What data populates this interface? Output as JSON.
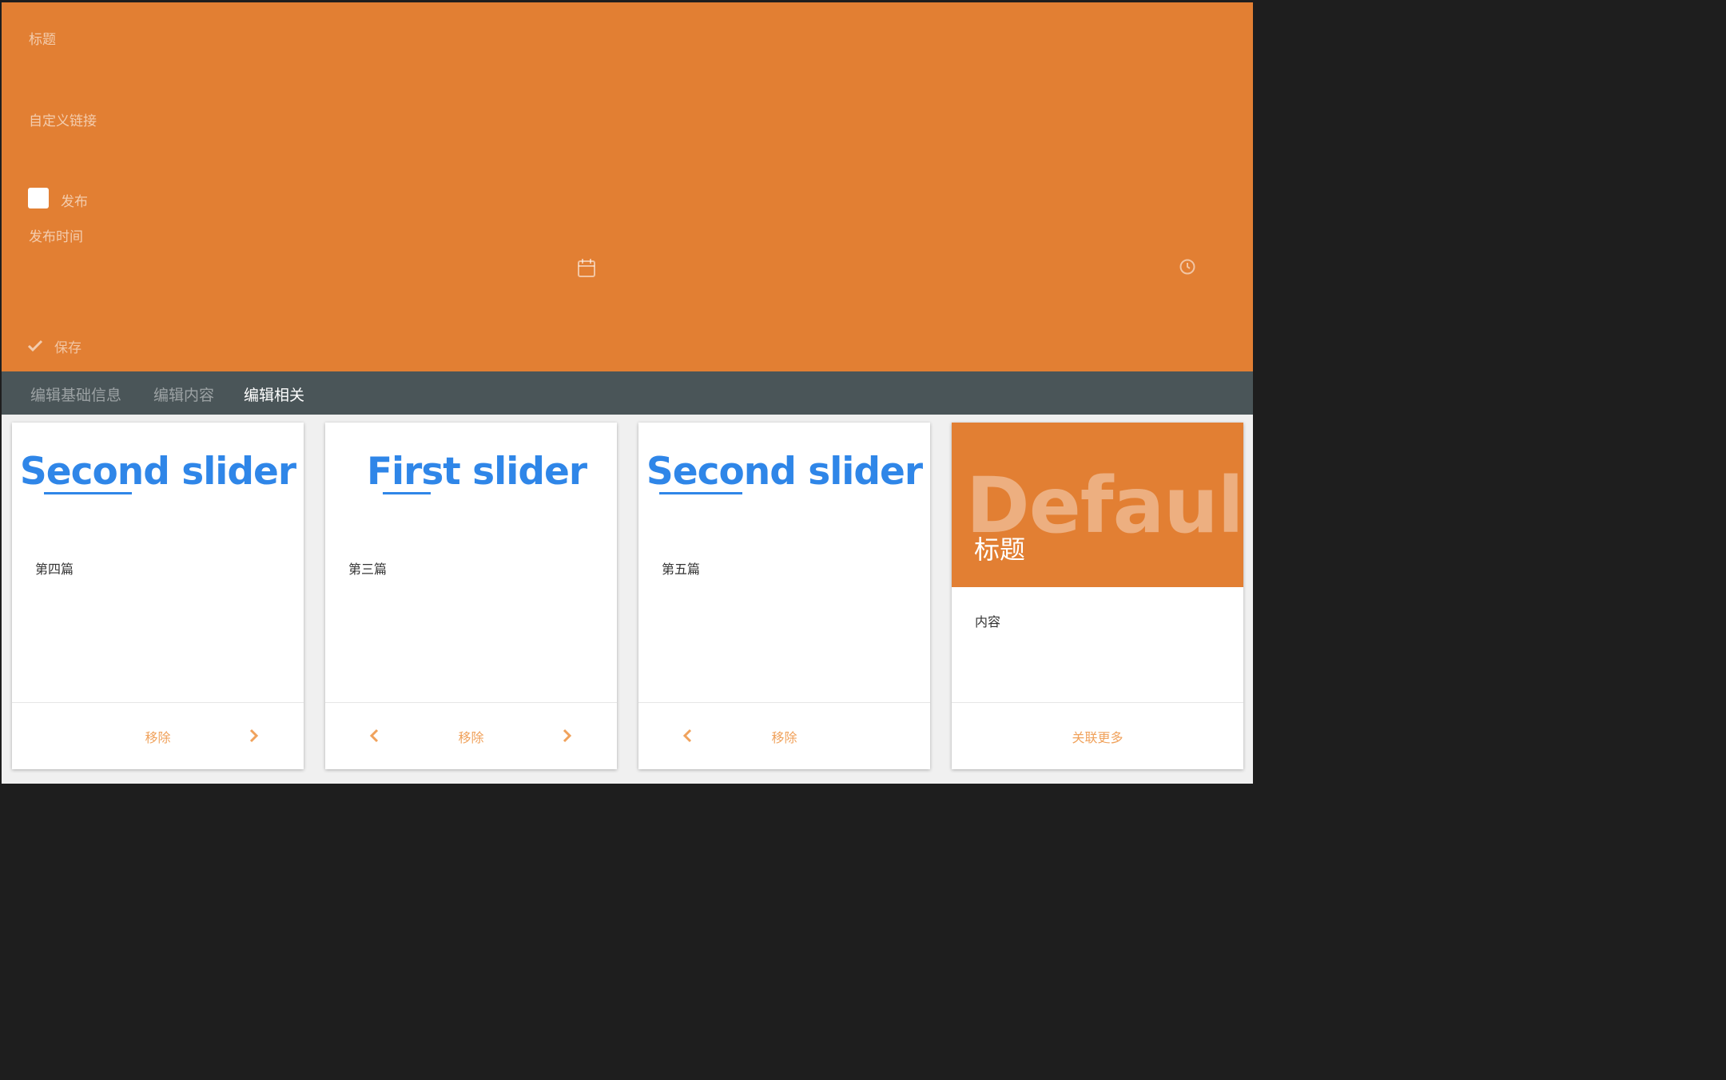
{
  "form": {
    "title_label": "标题",
    "link_label": "自定义链接",
    "publish_label": "发布",
    "publish_checked": false,
    "publish_time_label": "发布时间",
    "date_icon": "calendar-icon",
    "time_icon": "clock-icon",
    "save_label": "保存",
    "save_icon": "check-icon"
  },
  "tabs": [
    {
      "label": "编辑基础信息",
      "active": false
    },
    {
      "label": "编辑内容",
      "active": false
    },
    {
      "label": "编辑相关",
      "active": true
    }
  ],
  "cards": [
    {
      "image_text": "Second slider",
      "text": "第四篇",
      "remove_label": "移除",
      "has_prev": false,
      "has_next": true
    },
    {
      "image_text": "First slider",
      "text": "第三篇",
      "remove_label": "移除",
      "has_prev": true,
      "has_next": true
    },
    {
      "image_text": "Second slider",
      "text": "第五篇",
      "remove_label": "移除",
      "has_prev": true,
      "has_next": false
    }
  ],
  "default_card": {
    "image_text": "Default",
    "title": "标题",
    "content": "内容",
    "more_label": "关联更多"
  },
  "colors": {
    "primary": "#e27f33",
    "tabbar": "#4a5558",
    "slider_text": "#2f86e8",
    "action": "#f0a25c"
  }
}
